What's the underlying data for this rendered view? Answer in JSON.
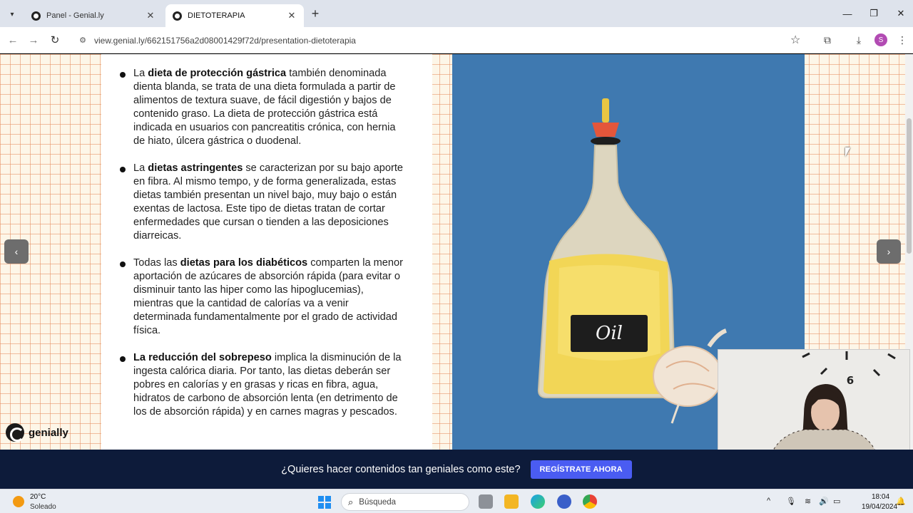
{
  "browser": {
    "tabs": [
      {
        "label": "Panel - Genial.ly",
        "active": false
      },
      {
        "label": "DIETOTERAPIA",
        "active": true
      }
    ],
    "url": "view.genial.ly/662151756a2d08001429f72d/presentation-dietoterapia",
    "profile_initial": "S"
  },
  "slide": {
    "bullets": [
      {
        "lead": "La ",
        "bold": "dieta de protección gástrica",
        "rest": " también denominada dienta blanda, se trata de una dieta formulada a partir de alimentos de textura suave, de fácil digestión y bajos de contenido graso. La dieta de protección gástrica está indicada en usuarios con pancreatitis crónica, con hernia de hiato, úlcera gástrica o duodenal."
      },
      {
        "lead": "La ",
        "bold": "dietas astringentes",
        "rest": " se caracterizan por su bajo aporte en fibra. Al mismo tempo, y de forma generalizada, estas dietas también presentan un nivel bajo, muy bajo o están exentas de lactosa. Este tipo de dietas tratan de cortar enfermedades que cursan o tienden a las deposiciones diarreicas."
      },
      {
        "lead": "Todas las ",
        "bold": "dietas para los diabéticos",
        "rest": " comparten la menor aportación de azúcares de absorción rápida (para evitar o disminuir tanto las hiper como las hipoglucemias), mientras que la cantidad de calorías va a venir determinada fundamentalmente por el grado de actividad física."
      },
      {
        "lead": "",
        "bold": "La reducción del sobrepeso",
        "rest": " implica la disminución de la ingesta calórica diaria. Por tanto, las dietas deberán ser pobres en calorías y en grasas y ricas en fibra, agua, hidratos de carbono de absorción lenta (en detrimento de los de absorción rápida) y en carnes magras y pescados."
      }
    ],
    "bottle_label": "Oil",
    "brand": "genially",
    "clock_number": "6"
  },
  "promo": {
    "text": "¿Quieres hacer contenidos tan geniales como este?",
    "button": "REGÍSTRATE AHORA"
  },
  "taskbar": {
    "weather_temp": "20°C",
    "weather_desc": "Soleado",
    "search_placeholder": "Búsqueda",
    "time": "18:04",
    "date": "19/04/2024"
  },
  "colors": {
    "slide_grid": "#e68c5f",
    "image_bg": "#3f79b0",
    "promo_bg": "#0d1b3a",
    "promo_button": "#4a5cf2"
  }
}
